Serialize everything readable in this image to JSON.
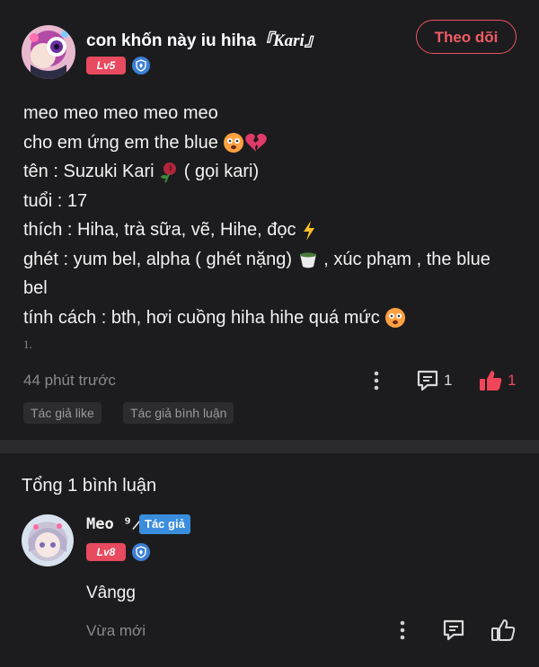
{
  "post": {
    "author": {
      "name": "con khốn này iu hiha",
      "name_suffix": "『Kari』",
      "level": "Lv5"
    },
    "follow_label": "Theo dõi",
    "lines": [
      "meo meo meo meo meo",
      "cho em ứng em the blue",
      "tên :  Suzuki Kari",
      "( gọi kari)",
      "tuổi : 17",
      "thích : Hiha, trà sữa, vẽ, Hihe, đọc",
      "ghét : yum bel, alpha ( ghét nặng)",
      ", xúc phạm , the blue bel",
      "tính cách : bth, hơi cuồng hiha hihe quá mức"
    ],
    "footnote": "1.",
    "time": "44 phút trước",
    "comment_count": "1",
    "like_count": "1",
    "tags": [
      "Tác giả like",
      "Tác giả bình luận"
    ]
  },
  "comments_section": {
    "title": "Tổng 1 bình luận",
    "comments": [
      {
        "name": "Meo ⁹̷⁹",
        "author_badge": "Tác giả",
        "level": "Lv8",
        "text": "Vângg",
        "time": "Vừa mới"
      }
    ]
  },
  "colors": {
    "background": "#1c1c1e",
    "accent_red": "#e84a5f",
    "like_red": "#f0455a",
    "badge_blue": "#3a8ddd",
    "muted_text": "#8a8a8e"
  },
  "icons": [
    "shield-verified-icon",
    "more-vertical-icon",
    "comment-icon",
    "thumbs-up-icon",
    "broken-heart-emoji",
    "flushed-face-emoji",
    "rose-emoji",
    "lightning-emoji",
    "tea-cup-emoji"
  ]
}
